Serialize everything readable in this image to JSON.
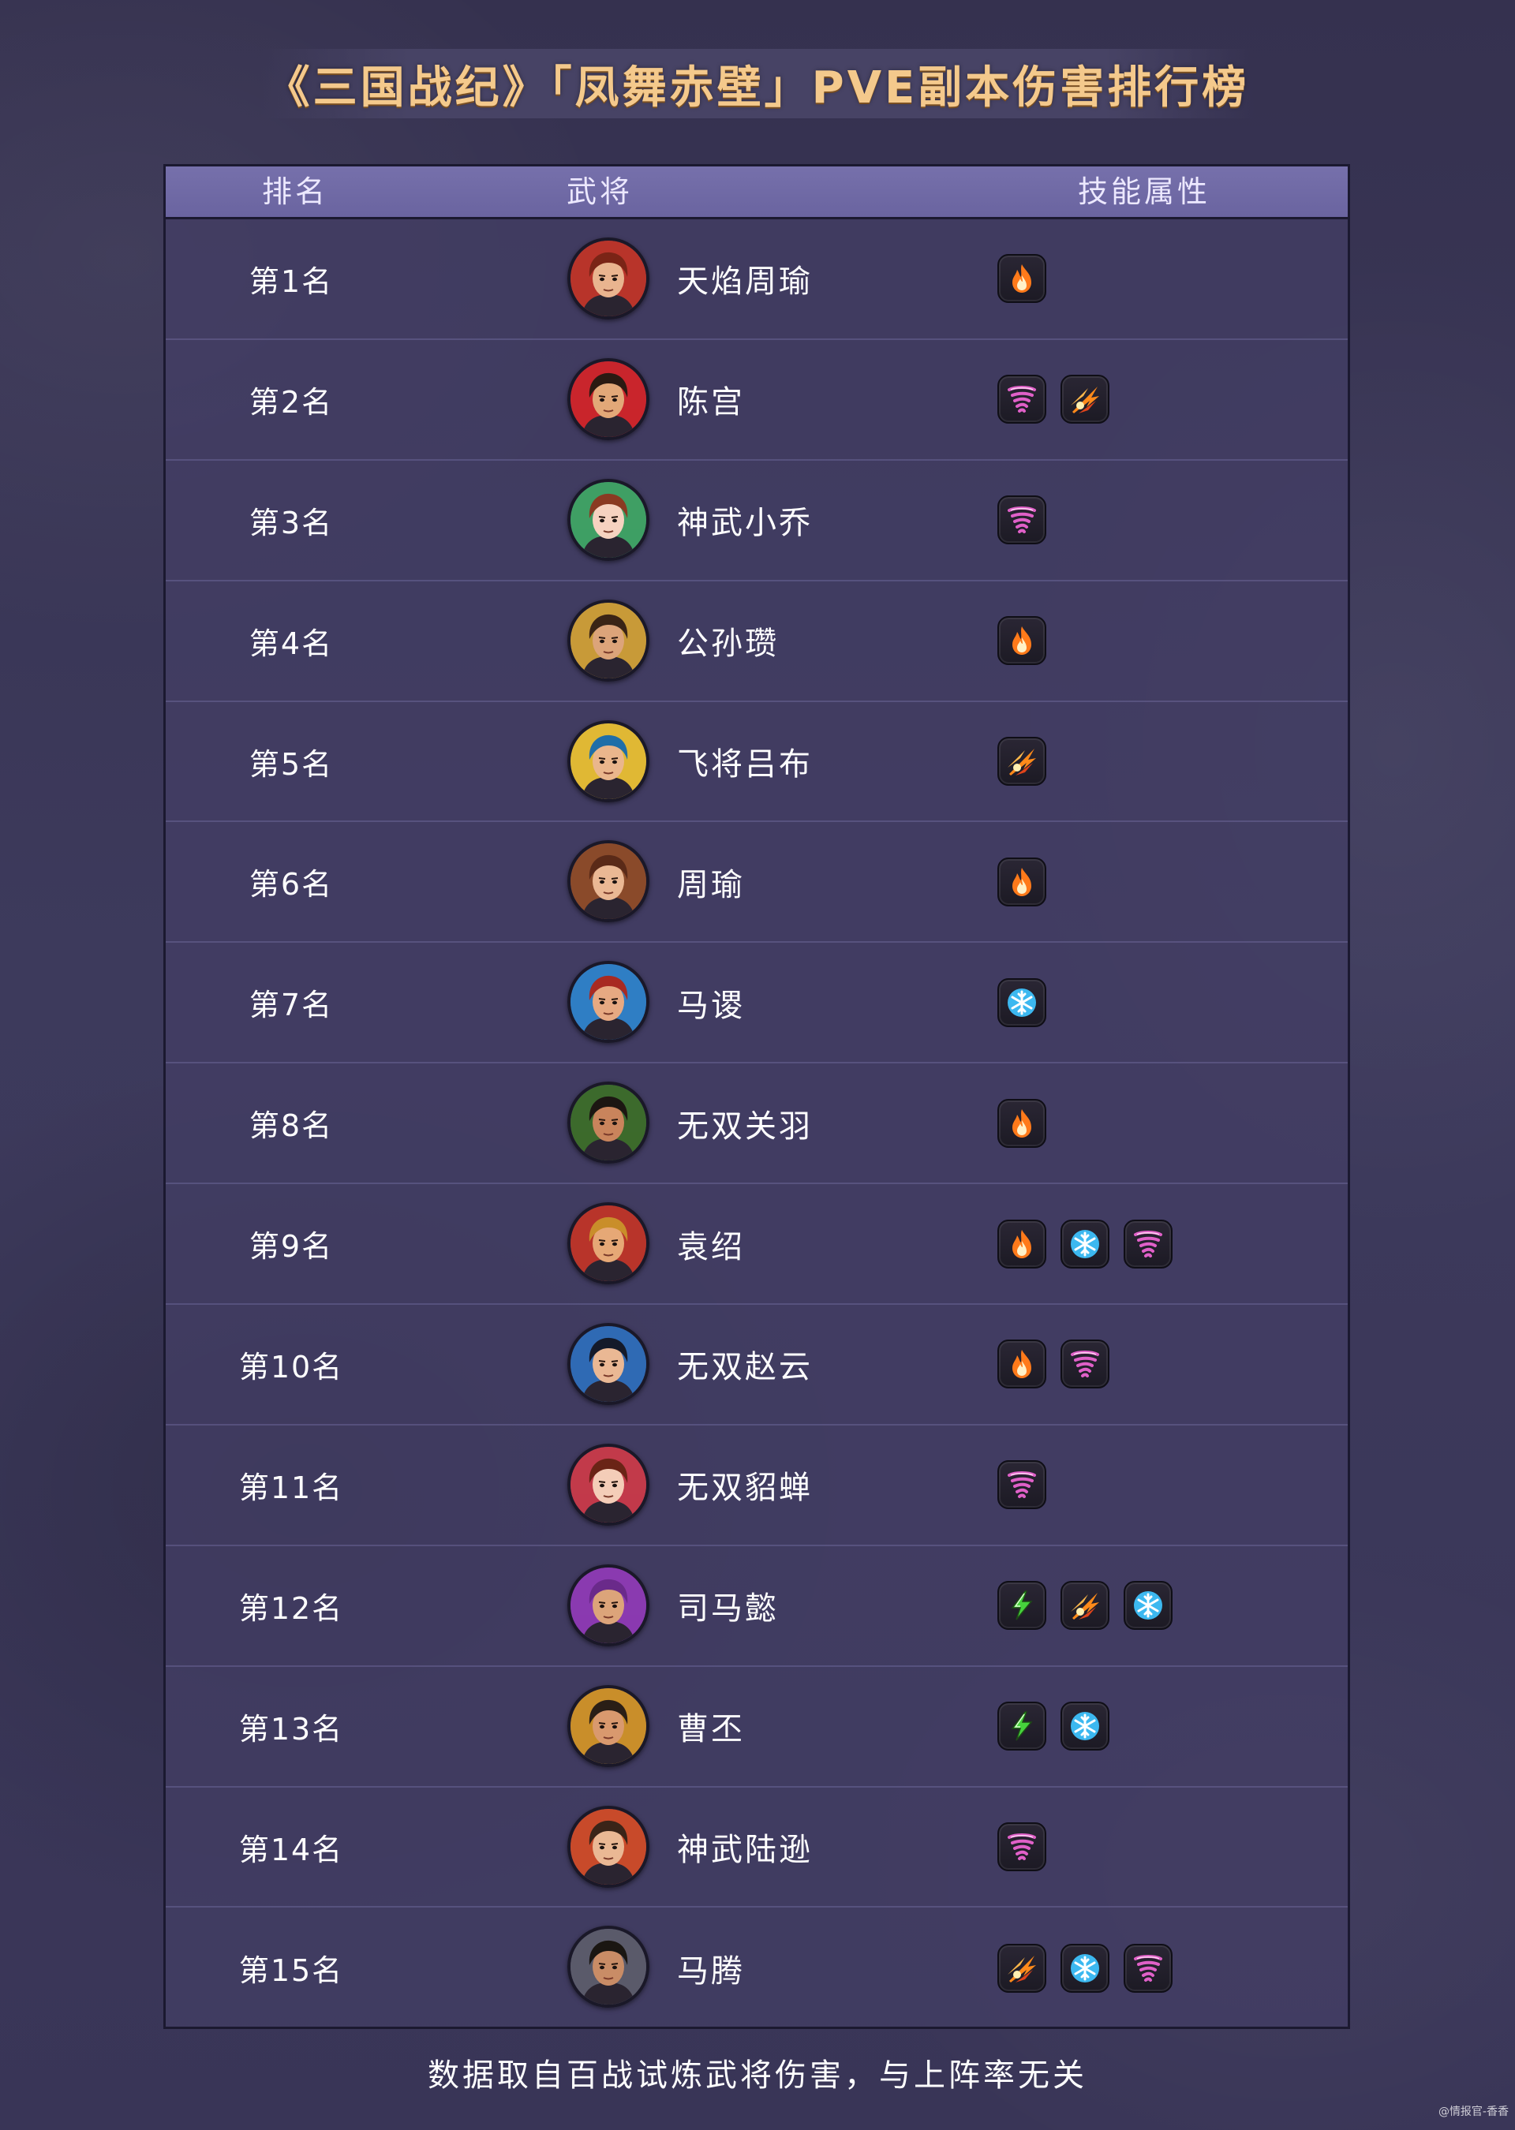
{
  "title": "《三国战纪》「凤舞赤壁」PVE副本伤害排行榜",
  "table": {
    "headers": {
      "rank": "排名",
      "hero": "武将",
      "skill": "技能属性"
    },
    "rows": [
      {
        "rank": "第1名",
        "name": "天焰周瑜",
        "skills": [
          "fire-icon"
        ],
        "avatar": {
          "skin": "#e9b48f",
          "hair": "#7a2416",
          "accent": "#b8342a"
        }
      },
      {
        "rank": "第2名",
        "name": "陈宫",
        "skills": [
          "whirlwind-icon",
          "burst-icon"
        ],
        "avatar": {
          "skin": "#e2a878",
          "hair": "#2a1a12",
          "accent": "#c9252c"
        }
      },
      {
        "rank": "第3名",
        "name": "神武小乔",
        "skills": [
          "whirlwind-icon"
        ],
        "avatar": {
          "skin": "#f6d2c0",
          "hair": "#8a3a22",
          "accent": "#3f9f64"
        }
      },
      {
        "rank": "第4名",
        "name": "公孙瓒",
        "skills": [
          "fire-icon"
        ],
        "avatar": {
          "skin": "#dca47a",
          "hair": "#3a2416",
          "accent": "#c89a38"
        }
      },
      {
        "rank": "第5名",
        "name": "飞将吕布",
        "skills": [
          "burst-icon"
        ],
        "avatar": {
          "skin": "#eab68c",
          "hair": "#1f6ea8",
          "accent": "#e0b834"
        }
      },
      {
        "rank": "第6名",
        "name": "周瑜",
        "skills": [
          "fire-icon"
        ],
        "avatar": {
          "skin": "#eab894",
          "hair": "#5a2a18",
          "accent": "#8a4a2a"
        }
      },
      {
        "rank": "第7名",
        "name": "马谡",
        "skills": [
          "frost-icon"
        ],
        "avatar": {
          "skin": "#e7a982",
          "hair": "#a82a22",
          "accent": "#2f7ec4"
        }
      },
      {
        "rank": "第8名",
        "name": "无双关羽",
        "skills": [
          "fire-icon"
        ],
        "avatar": {
          "skin": "#c9845c",
          "hair": "#1c1612",
          "accent": "#3c6a2c"
        }
      },
      {
        "rank": "第9名",
        "name": "袁绍",
        "skills": [
          "fire-icon",
          "frost-icon",
          "whirlwind-icon"
        ],
        "avatar": {
          "skin": "#e6a876",
          "hair": "#c98e2a",
          "accent": "#b8342a"
        }
      },
      {
        "rank": "第10名",
        "name": "无双赵云",
        "skills": [
          "fire-icon",
          "whirlwind-icon"
        ],
        "avatar": {
          "skin": "#eab894",
          "hair": "#141a2a",
          "accent": "#2f6ab4"
        }
      },
      {
        "rank": "第11名",
        "name": "无双貂蝉",
        "skills": [
          "whirlwind-icon"
        ],
        "avatar": {
          "skin": "#f4cdb8",
          "hair": "#6a2416",
          "accent": "#c23a4a"
        }
      },
      {
        "rank": "第12名",
        "name": "司马懿",
        "skills": [
          "thunder-icon",
          "burst-icon",
          "frost-icon"
        ],
        "avatar": {
          "skin": "#dca47a",
          "hair": "#6a2a8a",
          "accent": "#8a3ab0"
        }
      },
      {
        "rank": "第13名",
        "name": "曹丕",
        "skills": [
          "thunder-icon",
          "frost-icon"
        ],
        "avatar": {
          "skin": "#d9996e",
          "hair": "#2a1e16",
          "accent": "#c98e2a"
        }
      },
      {
        "rank": "第14名",
        "name": "神武陆逊",
        "skills": [
          "whirlwind-icon"
        ],
        "avatar": {
          "skin": "#eab894",
          "hair": "#3a2418",
          "accent": "#c84a2a"
        }
      },
      {
        "rank": "第15名",
        "name": "马腾",
        "skills": [
          "burst-icon",
          "frost-icon",
          "whirlwind-icon"
        ],
        "avatar": {
          "skin": "#c98c66",
          "hair": "#1a1612",
          "accent": "#5a5a6a"
        }
      }
    ]
  },
  "footer_note": "数据取自百战试炼武将伤害，与上阵率无关",
  "watermark": "@情报官-香香",
  "colors": {
    "title": "#f4c98c",
    "header_bg": "#7670ab",
    "background": "#3a3656",
    "fire": "#ff7a1a",
    "frost": "#3cb8f0",
    "whirlwind": "#e060c8",
    "thunder": "#46d23c",
    "burst": "#ff8a1a"
  }
}
